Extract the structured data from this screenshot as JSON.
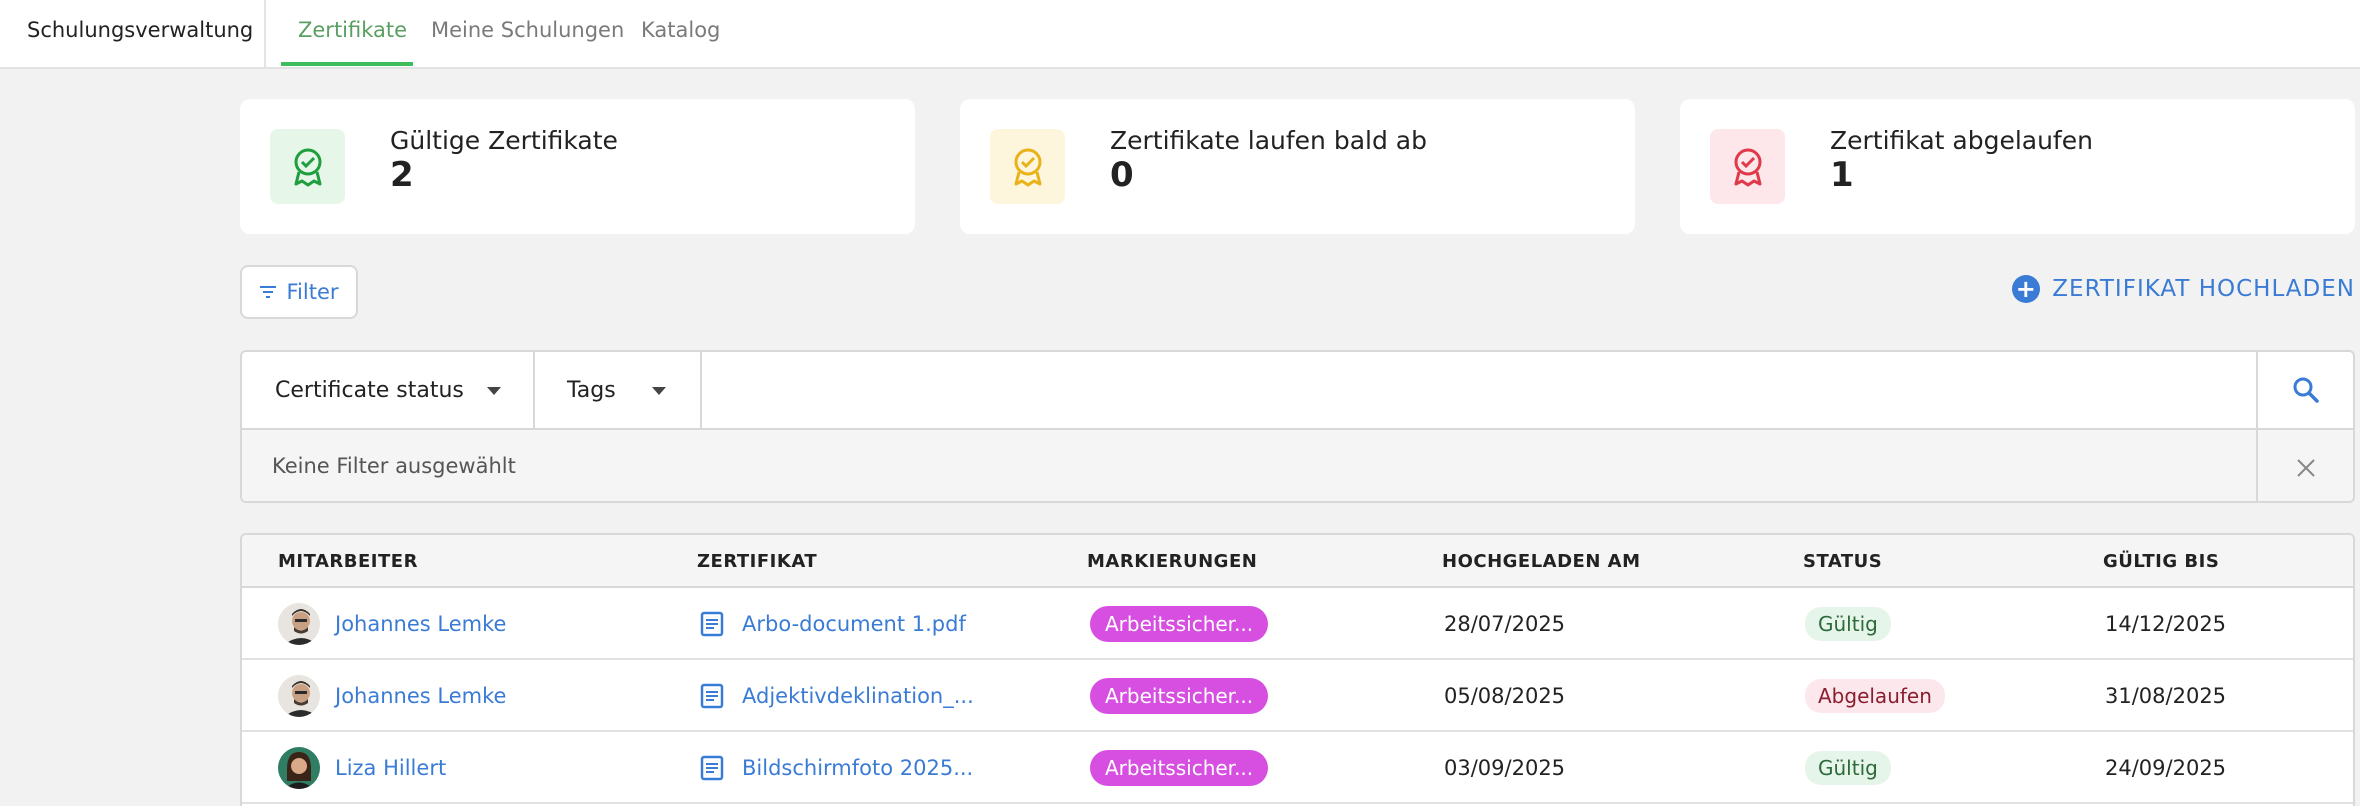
{
  "app": {
    "title": "Schulungsverwaltung"
  },
  "tabs": [
    {
      "label": "Zertifikate",
      "active": true
    },
    {
      "label": "Meine Schulungen",
      "active": false
    },
    {
      "label": "Katalog",
      "active": false
    }
  ],
  "stats": [
    {
      "label": "Gültige Zertifikate",
      "count": "2",
      "color": "#1e9e3c",
      "bg": "#e6f7ea",
      "icon": "certificate-valid-icon"
    },
    {
      "label": "Zertifikate laufen bald ab",
      "count": "0",
      "color": "#e9b21a",
      "bg": "#fdf6dc",
      "icon": "certificate-expiring-icon"
    },
    {
      "label": "Zertifikat abgelaufen",
      "count": "1",
      "color": "#e0394a",
      "bg": "#fde7ea",
      "icon": "certificate-expired-icon"
    }
  ],
  "toolbar": {
    "filter_label": "Filter",
    "upload_label": "ZERTIFIKAT HOCHLADEN"
  },
  "search": {
    "status_dropdown": "Certificate status",
    "tags_dropdown": "Tags",
    "placeholder": "",
    "no_filter_text": "Keine Filter ausgewählt"
  },
  "table": {
    "headers": {
      "employee": "MITARBEITER",
      "certificate": "ZERTIFIKAT",
      "tags": "MARKIERUNGEN",
      "uploaded": "HOCHGELADEN AM",
      "status": "STATUS",
      "valid_until": "GÜLTIG BIS"
    },
    "rows": [
      {
        "employee": "Johannes Lemke",
        "certificate": "Arbo-document 1.pdf",
        "tag": "Arbeitssicher...",
        "uploaded": "28/07/2025",
        "status": "Gültig",
        "status_kind": "ok",
        "valid_until": "14/12/2025"
      },
      {
        "employee": "Johannes Lemke",
        "certificate": "Adjektivdeklination_...",
        "tag": "Arbeitssicher...",
        "uploaded": "05/08/2025",
        "status": "Abgelaufen",
        "status_kind": "bad",
        "valid_until": "31/08/2025"
      },
      {
        "employee": "Liza Hillert",
        "certificate": "Bildschirmfoto 2025...",
        "tag": "Arbeitssicher...",
        "uploaded": "03/09/2025",
        "status": "Gültig",
        "status_kind": "ok",
        "valid_until": "24/09/2025"
      }
    ]
  },
  "colors": {
    "accent": "#3a7bd5",
    "tab_active": "#3fbd5a",
    "tag": "#d64fe0"
  }
}
